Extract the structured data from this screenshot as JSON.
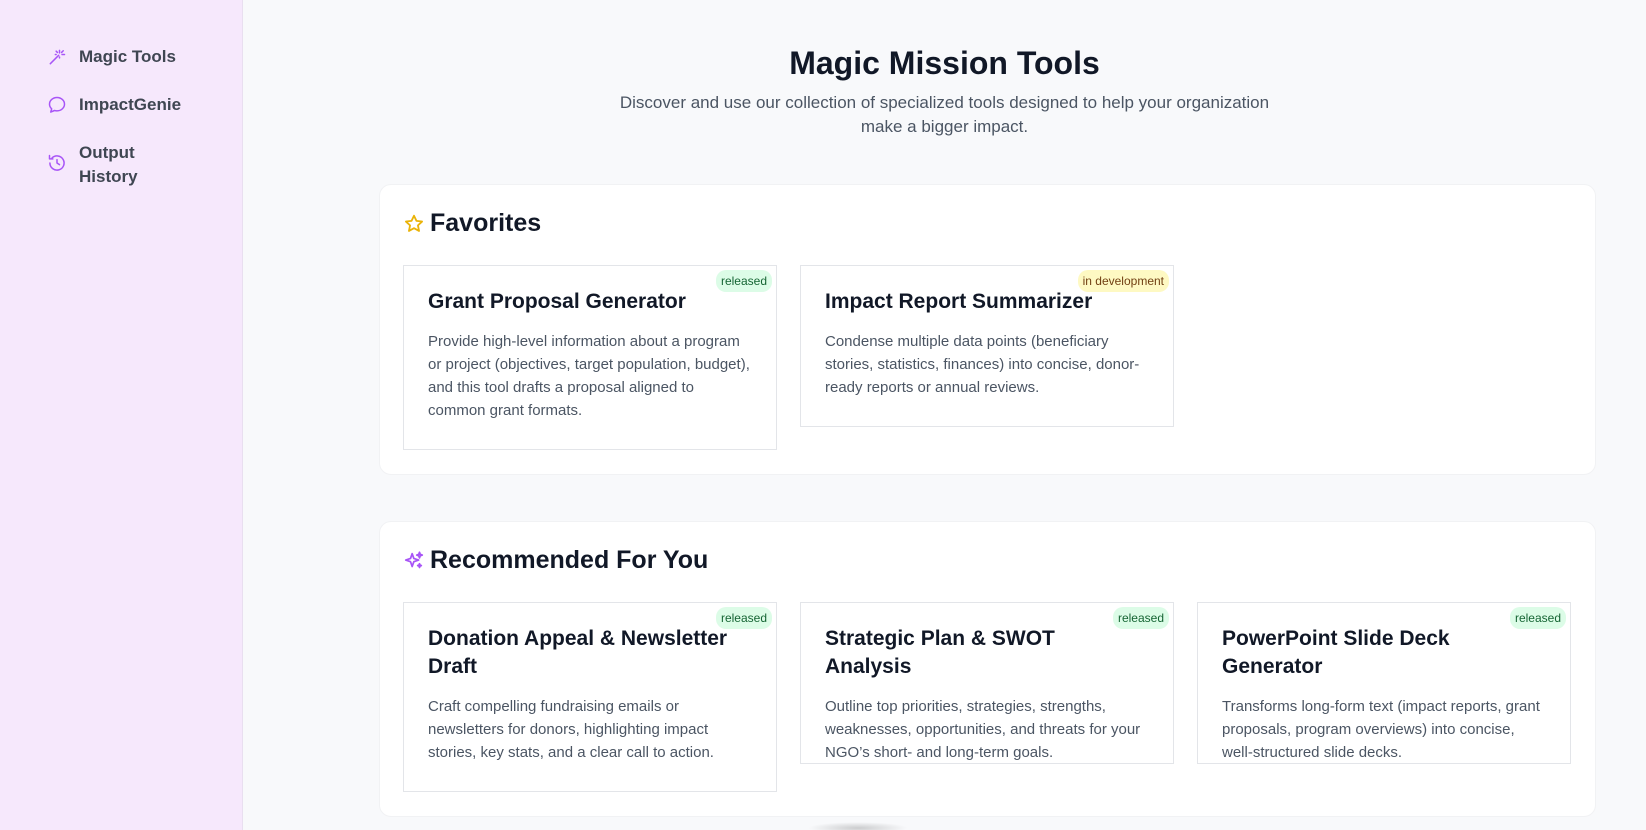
{
  "sidebar": {
    "items": [
      {
        "label": "Magic Tools",
        "icon": "magic-wand-icon"
      },
      {
        "label": "ImpactGenie",
        "icon": "chat-bubble-icon"
      },
      {
        "label": "Output History",
        "icon": "history-icon"
      }
    ]
  },
  "header": {
    "title": "Magic Mission Tools",
    "subtitle": "Discover and use our collection of specialized tools designed to help your organization make a bigger impact."
  },
  "favorites": {
    "title": "Favorites",
    "icon": "star-icon",
    "cards": [
      {
        "title": "Grant Proposal Generator",
        "status": "released",
        "description": "Provide high-level information about a program or project (objectives, target population, budget), and this tool drafts a proposal aligned to common grant formats."
      },
      {
        "title": "Impact Report Summarizer",
        "status": "in development",
        "description": "Condense multiple data points (beneficiary stories, statistics, finances) into concise, donor-ready reports or annual reviews."
      }
    ]
  },
  "recommended": {
    "title": "Recommended For You",
    "icon": "sparkles-icon",
    "cards": [
      {
        "title": "Donation Appeal & Newsletter Draft",
        "status": "released",
        "description": "Craft compelling fundraising emails or newsletters for donors, highlighting impact stories, key stats, and a clear call to action."
      },
      {
        "title": "Strategic Plan & SWOT Analysis",
        "status": "released",
        "description": "Outline top priorities, strategies, strengths, weaknesses, opportunities, and threats for your NGO’s short- and long-term goals."
      },
      {
        "title": "PowerPoint Slide Deck Generator",
        "status": "released",
        "description": "Transforms long-form text (impact reports, grant proposals, program overviews) into concise, well-structured slide decks."
      }
    ]
  },
  "colors": {
    "accent": "#a855f7",
    "star": "#eab308",
    "sidebar_bg": "#f6e8fc"
  }
}
